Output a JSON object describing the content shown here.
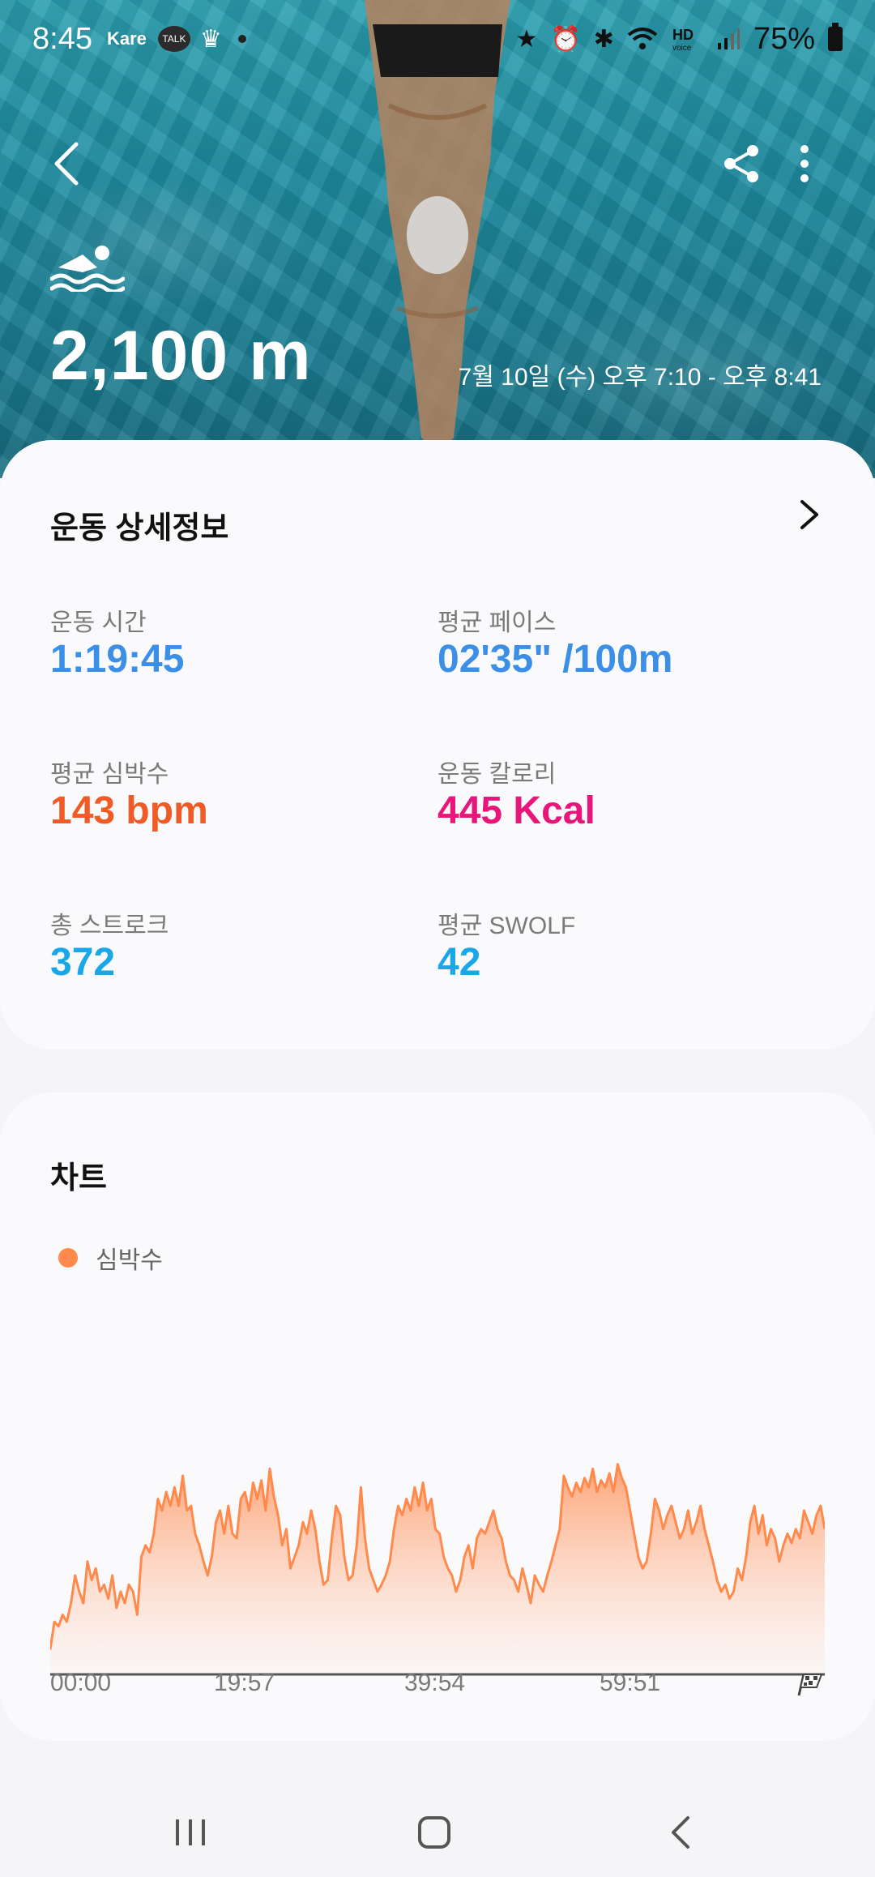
{
  "status_bar": {
    "time": "8:45",
    "app_label": "Kare",
    "talk_label": "TALK",
    "battery_percent": "75%",
    "icons": [
      "star-icon",
      "alarm-icon",
      "bluetooth-icon",
      "wifi-icon",
      "hd-voice-icon",
      "signal-icon",
      "battery-icon"
    ]
  },
  "header": {
    "activity_icon": "swimming-icon",
    "distance": "2,100 m",
    "datetime": "7월 10일 (수) 오후 7:10 - 오후 8:41"
  },
  "details": {
    "title": "운동 상세정보",
    "metrics": [
      {
        "label": "운동 시간",
        "value": "1:19:45",
        "color": "#3b8fe6"
      },
      {
        "label": "평균 페이스",
        "value": "02'35\" /100m",
        "color": "#3b8fe6"
      },
      {
        "label": "평균 심박수",
        "value": "143 bpm",
        "color": "#f05a24"
      },
      {
        "label": "운동 칼로리",
        "value": "445 Kcal",
        "color": "#e8157a"
      },
      {
        "label": "총 스트로크",
        "value": "372",
        "color": "#1aa7e8"
      },
      {
        "label": "평균 SWOLF",
        "value": "42",
        "color": "#1aa7e8"
      }
    ]
  },
  "chart_section": {
    "title": "차트",
    "legend": "심박수",
    "finish_icon": "checkered-flag-icon"
  },
  "chart_data": {
    "type": "area",
    "x_ticks": [
      "00:00",
      "19:57",
      "39:54",
      "59:51"
    ],
    "series": [
      {
        "name": "심박수",
        "color": "#ff8a4c",
        "values": [
          0.1,
          0.22,
          0.2,
          0.25,
          0.22,
          0.3,
          0.42,
          0.35,
          0.3,
          0.48,
          0.4,
          0.45,
          0.35,
          0.38,
          0.32,
          0.42,
          0.28,
          0.35,
          0.3,
          0.38,
          0.35,
          0.25,
          0.5,
          0.55,
          0.52,
          0.6,
          0.75,
          0.7,
          0.78,
          0.72,
          0.8,
          0.72,
          0.85,
          0.7,
          0.72,
          0.6,
          0.55,
          0.48,
          0.42,
          0.5,
          0.65,
          0.7,
          0.6,
          0.72,
          0.6,
          0.58,
          0.75,
          0.78,
          0.7,
          0.82,
          0.75,
          0.83,
          0.7,
          0.88,
          0.76,
          0.68,
          0.55,
          0.62,
          0.45,
          0.5,
          0.55,
          0.65,
          0.6,
          0.7,
          0.62,
          0.48,
          0.38,
          0.4,
          0.58,
          0.72,
          0.68,
          0.5,
          0.4,
          0.42,
          0.55,
          0.8,
          0.58,
          0.45,
          0.4,
          0.35,
          0.38,
          0.42,
          0.48,
          0.62,
          0.72,
          0.68,
          0.75,
          0.7,
          0.8,
          0.72,
          0.82,
          0.7,
          0.75,
          0.62,
          0.6,
          0.5,
          0.45,
          0.42,
          0.35,
          0.4,
          0.5,
          0.55,
          0.45,
          0.58,
          0.62,
          0.6,
          0.65,
          0.7,
          0.62,
          0.58,
          0.48,
          0.42,
          0.4,
          0.35,
          0.45,
          0.38,
          0.3,
          0.42,
          0.38,
          0.35,
          0.42,
          0.48,
          0.55,
          0.62,
          0.85,
          0.8,
          0.76,
          0.82,
          0.78,
          0.84,
          0.8,
          0.88,
          0.78,
          0.83,
          0.8,
          0.86,
          0.78,
          0.9,
          0.84,
          0.8,
          0.7,
          0.6,
          0.5,
          0.45,
          0.48,
          0.6,
          0.75,
          0.7,
          0.62,
          0.68,
          0.72,
          0.65,
          0.58,
          0.62,
          0.7,
          0.6,
          0.65,
          0.72,
          0.62,
          0.55,
          0.48,
          0.4,
          0.35,
          0.38,
          0.32,
          0.35,
          0.45,
          0.4,
          0.5,
          0.65,
          0.72,
          0.6,
          0.68,
          0.55,
          0.62,
          0.58,
          0.48,
          0.55,
          0.6,
          0.56,
          0.62,
          0.58,
          0.7,
          0.65,
          0.6,
          0.68,
          0.72,
          0.62
        ],
        "ylim": [
          0,
          1
        ]
      }
    ]
  },
  "nav": {
    "recents_icon": "recents-icon",
    "home_icon": "home-icon",
    "back_icon": "back-nav-icon"
  }
}
